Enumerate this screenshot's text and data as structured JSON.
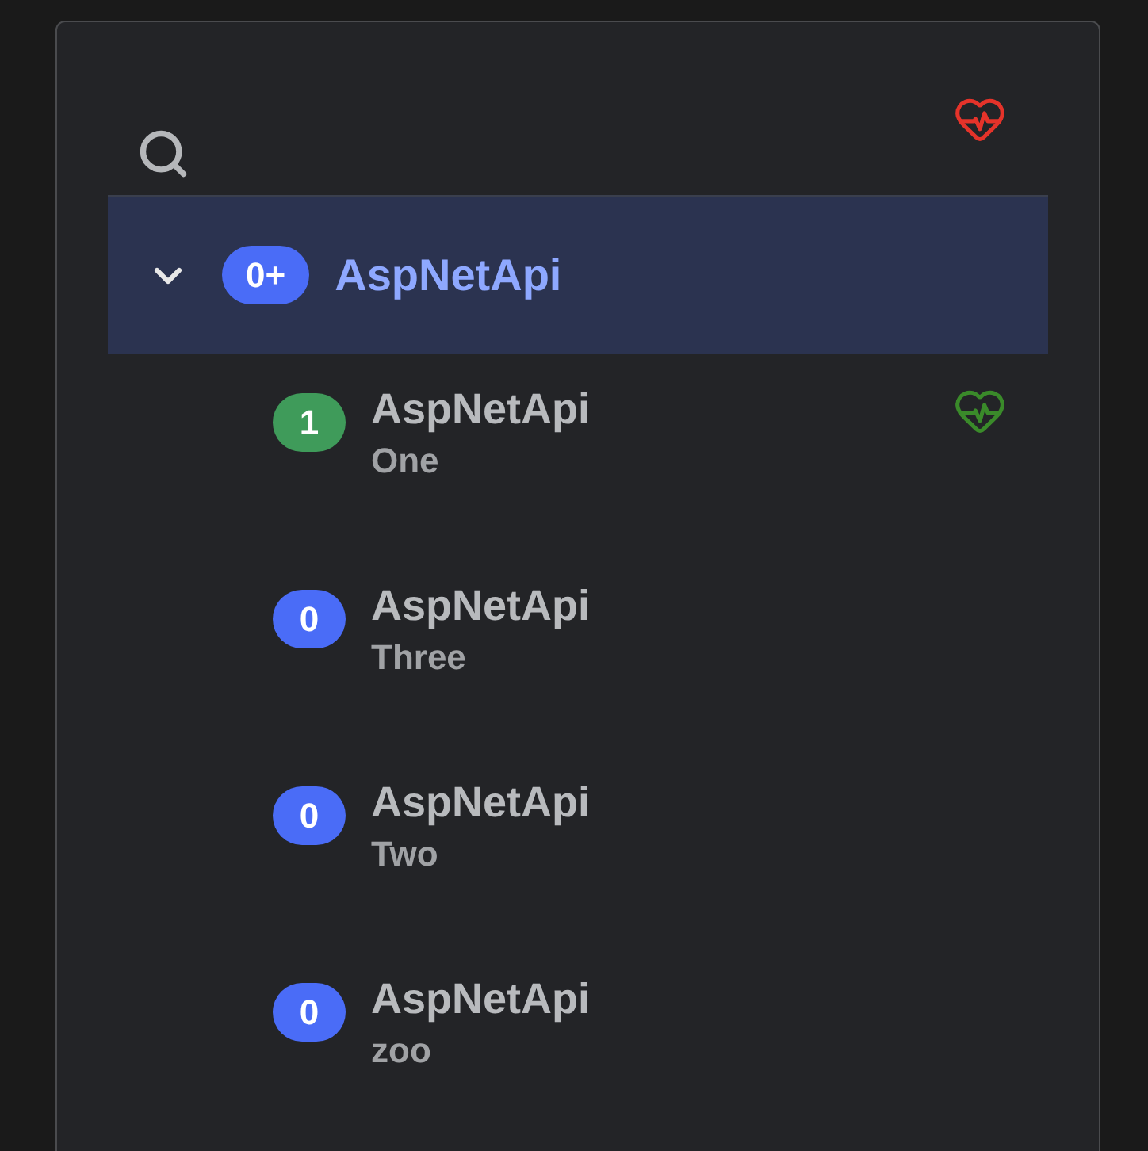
{
  "header": {
    "healthy": false
  },
  "group": {
    "badge": "0+",
    "label": "AspNetApi",
    "expanded": true,
    "selected": true,
    "color": "#4a6cf7",
    "children": [
      {
        "badge": "1",
        "title": "AspNetApi",
        "subtitle": "One",
        "color": "#3f9b5a",
        "healthy": true
      },
      {
        "badge": "0",
        "title": "AspNetApi",
        "subtitle": "Three",
        "color": "#4a6cf7"
      },
      {
        "badge": "0",
        "title": "AspNetApi",
        "subtitle": "Two",
        "color": "#4a6cf7"
      },
      {
        "badge": "0",
        "title": "AspNetApi",
        "subtitle": "zoo",
        "color": "#4a6cf7"
      }
    ]
  }
}
